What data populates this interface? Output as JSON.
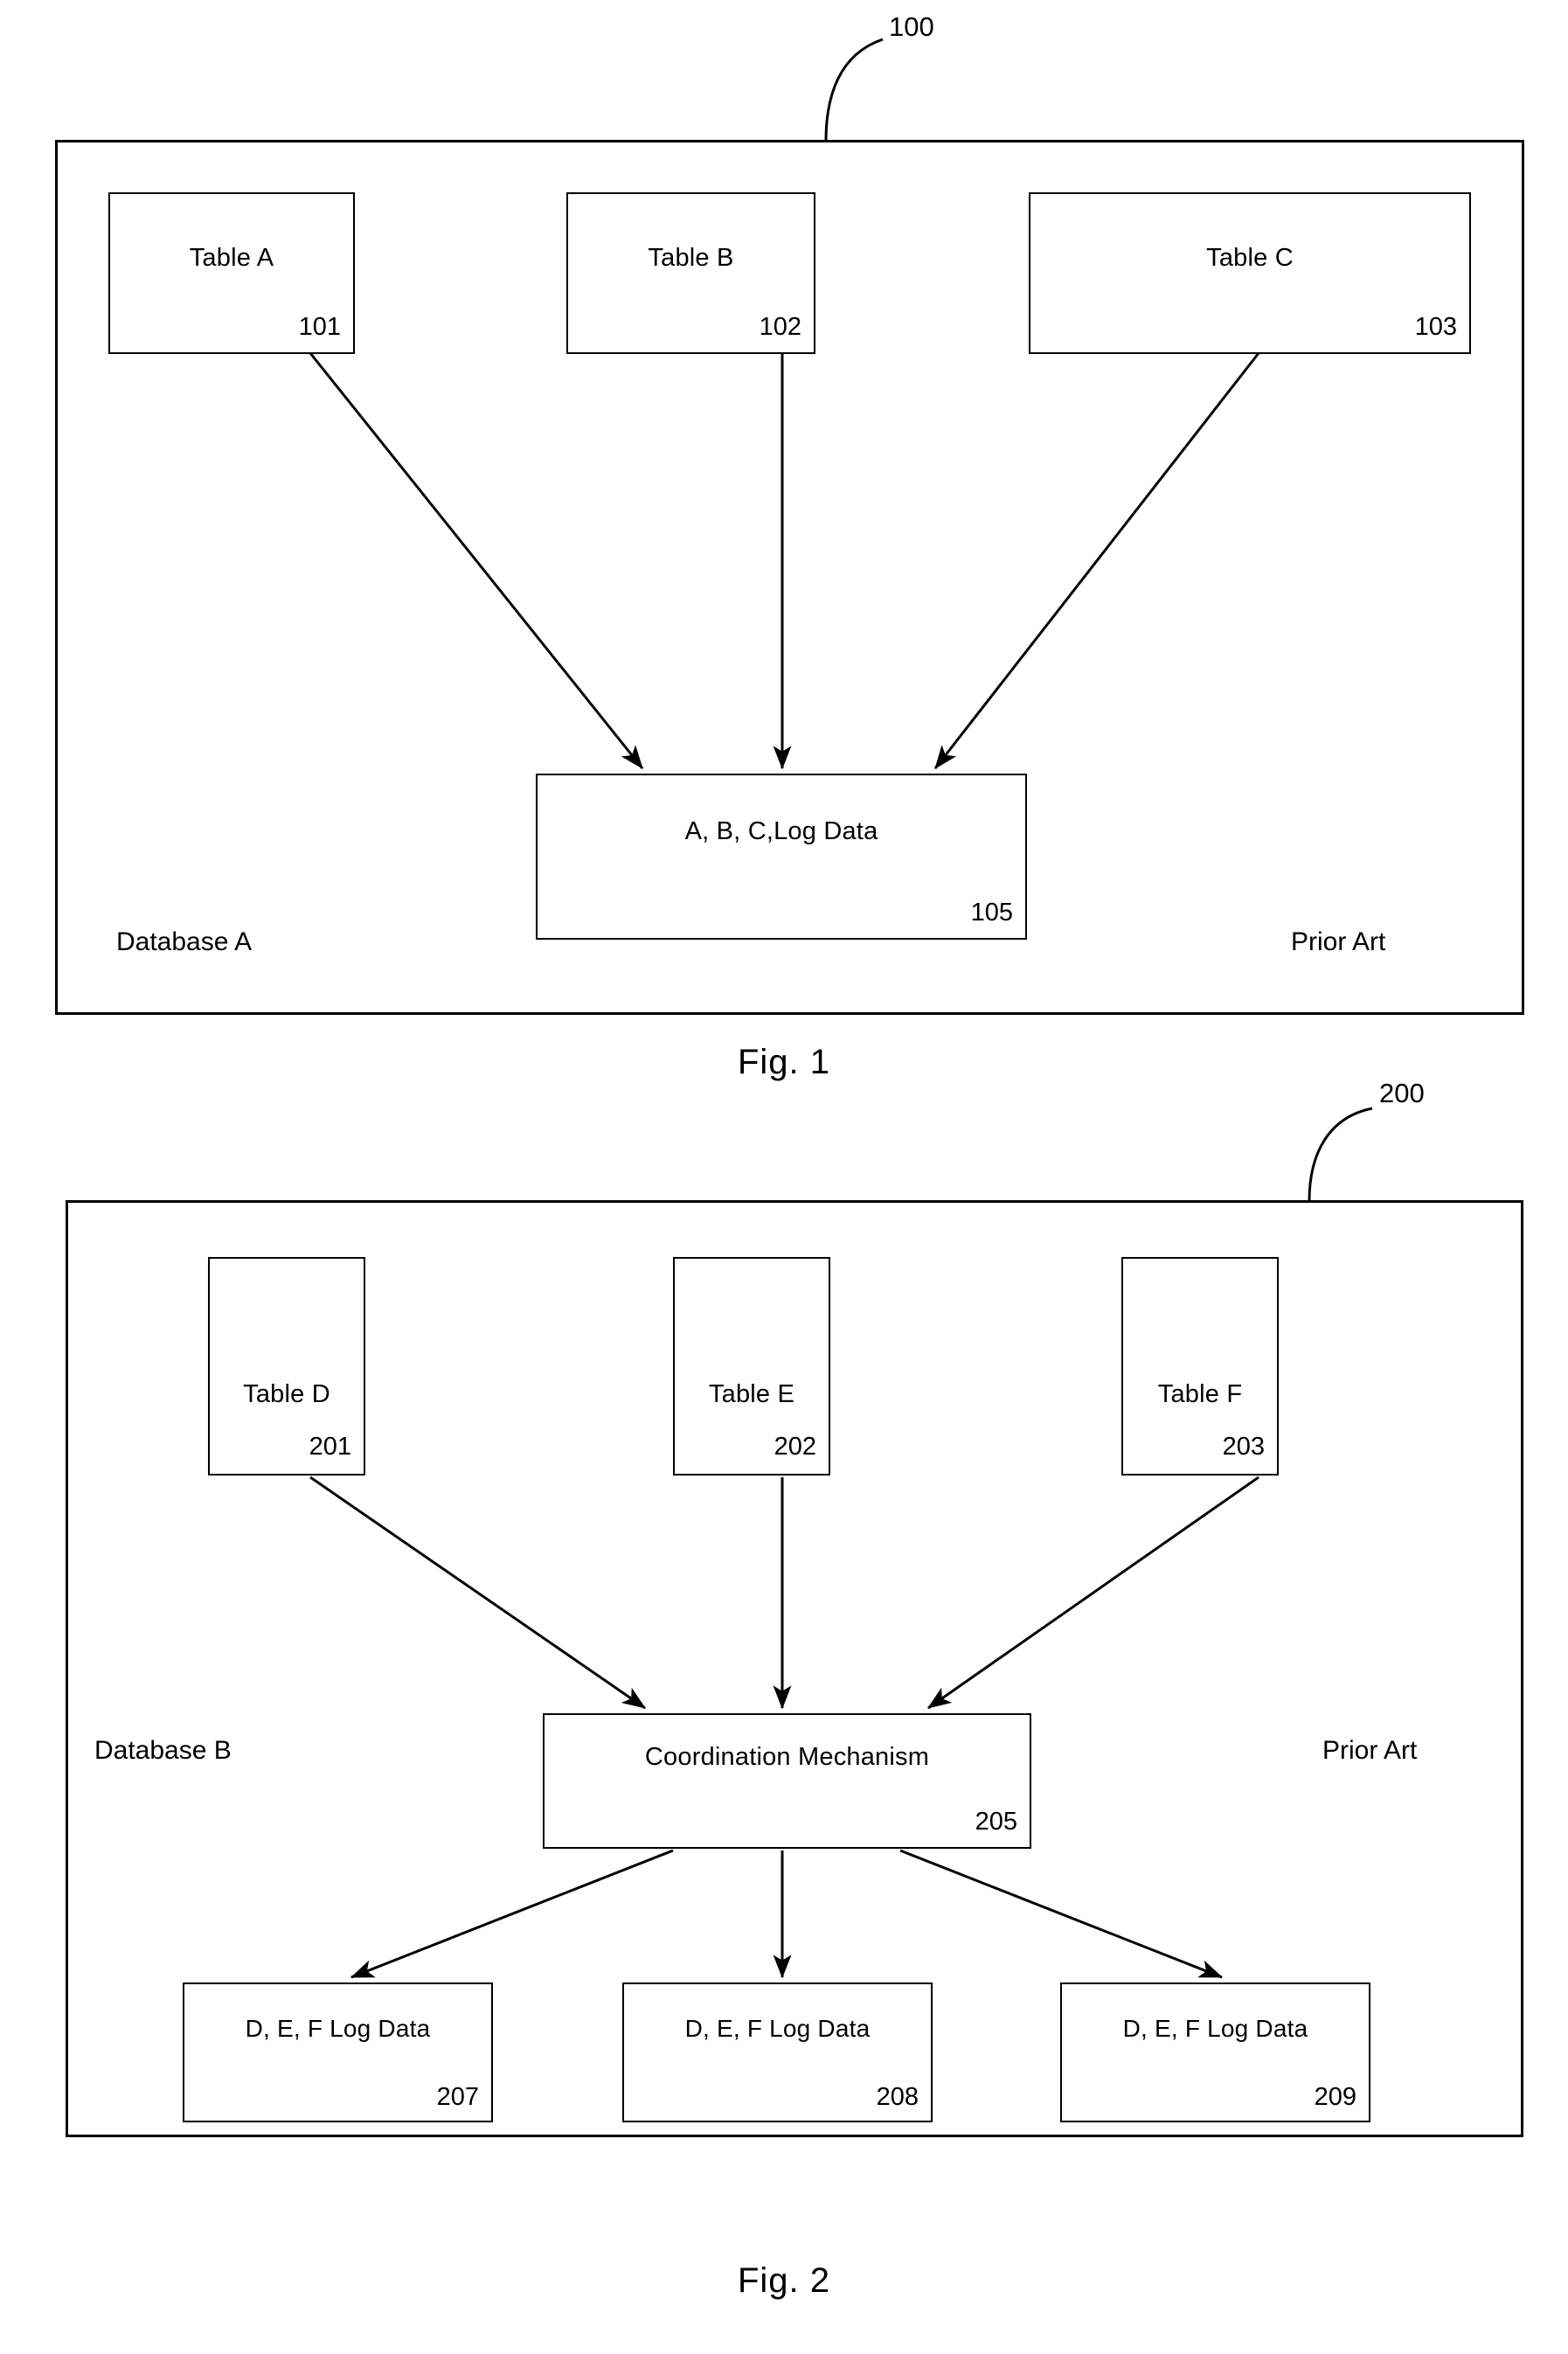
{
  "document": {
    "type": "patent-drawing-sheet",
    "figures": [
      {
        "caption": "Fig. 1",
        "frame_ref": "100",
        "left_label": "Database A",
        "right_label": "Prior Art",
        "source_boxes": [
          {
            "label": "Table A",
            "ref": "101"
          },
          {
            "label": "Table B",
            "ref": "102"
          },
          {
            "label": "Table C",
            "ref": "103"
          }
        ],
        "target_boxes": [
          {
            "label": "A, B, C,Log Data",
            "ref": "105"
          }
        ]
      },
      {
        "caption": "Fig. 2",
        "frame_ref": "200",
        "left_label": "Database B",
        "right_label": "Prior Art",
        "source_boxes": [
          {
            "label": "Table D",
            "ref": "201"
          },
          {
            "label": "Table E",
            "ref": "202"
          },
          {
            "label": "Table F",
            "ref": "203"
          }
        ],
        "middle_boxes": [
          {
            "label": "Coordination Mechanism",
            "ref": "205"
          }
        ],
        "target_boxes": [
          {
            "label": "D, E, F Log Data",
            "ref": "207"
          },
          {
            "label": "D, E, F Log Data",
            "ref": "208"
          },
          {
            "label": "D, E, F Log Data",
            "ref": "209"
          }
        ]
      }
    ]
  },
  "colors": {
    "ink": "#000000",
    "paper": "#ffffff"
  }
}
